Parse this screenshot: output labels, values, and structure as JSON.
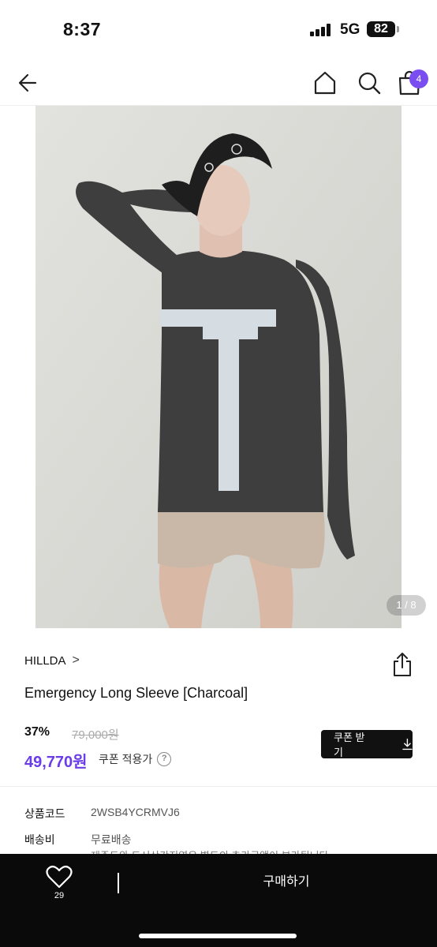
{
  "status_bar": {
    "time": "8:37",
    "network": "5G",
    "battery": "82"
  },
  "nav": {
    "cart_count": "4"
  },
  "gallery": {
    "counter": "1 / 8",
    "current_page": 1,
    "total_pages": 8
  },
  "product": {
    "brand": "HILLDA",
    "brand_chevron": ">",
    "title": "Emergency Long Sleeve [Charcoal]",
    "discount_rate": "37%",
    "original_price": "79,000원",
    "sale_price": "49,770원",
    "coupon_applied_label": "쿠폰 적용가",
    "coupon_button_label": "쿠폰 받기",
    "help_icon": "?"
  },
  "details": {
    "code_label": "상품코드",
    "code_value": "2WSB4YCRMVJ6",
    "shipping_label": "배송비",
    "shipping_value": "무료배송",
    "shipping_note": "제주도와 도서산간지역은 별도의 추가금액이 부가됩니다"
  },
  "bottom_bar": {
    "like_count": "29",
    "buy_label": "구매하기"
  },
  "colors": {
    "accent": "#6a3de8",
    "badge": "#7a4df0",
    "bottom_bar": "#0a0a0a"
  },
  "icons": [
    "back-arrow-icon",
    "home-icon",
    "search-icon",
    "shopping-bag-icon",
    "share-icon",
    "download-icon",
    "heart-icon",
    "help-icon"
  ]
}
